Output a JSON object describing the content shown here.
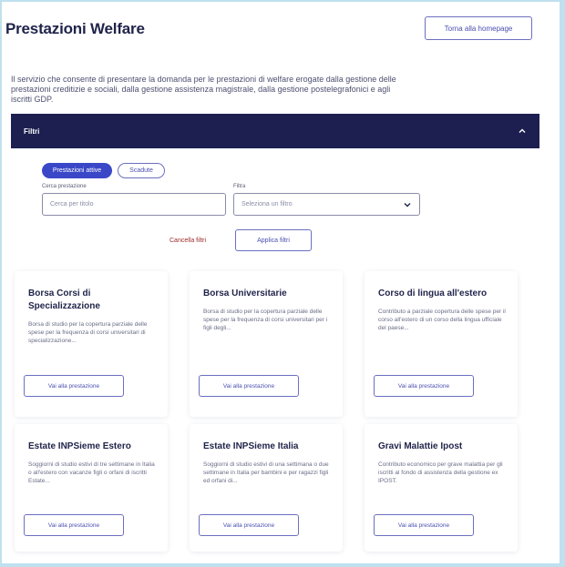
{
  "header": {
    "title": "Prestazioni Welfare",
    "home_button": "Torna alla homepage"
  },
  "intro": {
    "text": "Il servizio che consente di presentare la domanda per le prestazioni di welfare erogate dalla gestione delle prestazioni creditizie e sociali, dalla gestione assistenza magistrale, dalla gestione postelegrafonici e agli iscritti GDP."
  },
  "filters": {
    "title": "Filtri",
    "pill_active": "Prestazioni attive",
    "pill_inactive": "Scadute",
    "search_label": "Cerca prestazione",
    "search_placeholder": "Cerca per titolo",
    "select_label": "Filtra",
    "select_value": "Seleziona un filtro",
    "cancel_label": "Cancella filtri",
    "apply_label": "Applica filtri"
  },
  "cards": [
    {
      "title": "Borsa Corsi di Specializzazione",
      "desc": "Borsa di studio per la copertura parziale delle spese per la frequenza di corsi universitari di specializzazione...",
      "button": "Vai alla prestazione"
    },
    {
      "title": "Borsa Universitarie",
      "desc": "Borsa di studio per la copertura parziale delle spese per la frequenza di corsi universitari per i figli degli...",
      "button": "Vai alla prestazione"
    },
    {
      "title": "Corso di lingua all'estero",
      "desc": "Contributo a parziale copertura delle spese per il corso all'estero di un corso della lingua ufficiale del paese...",
      "button": "Vai alla prestazione"
    },
    {
      "title": "Estate INPSieme Estero",
      "desc": "Soggiorni di studio estivi di tre settimane in Italia o all'estero con vacanze figli o orfani di iscritti Estate...",
      "button": "Vai alla prestazione"
    },
    {
      "title": "Estate INPSieme Italia",
      "desc": "Soggiorni di studio estivi di una settimana o due settimane in Italia per bambini e per ragazzi figli ed orfani di...",
      "button": "Vai alla prestazione"
    },
    {
      "title": "Gravi Malattie Ipost",
      "desc": "Contributo economico per grave malattia per gli iscritti al fondo di assistenza della gestione ex IPOST.",
      "button": "Vai alla prestazione"
    }
  ]
}
